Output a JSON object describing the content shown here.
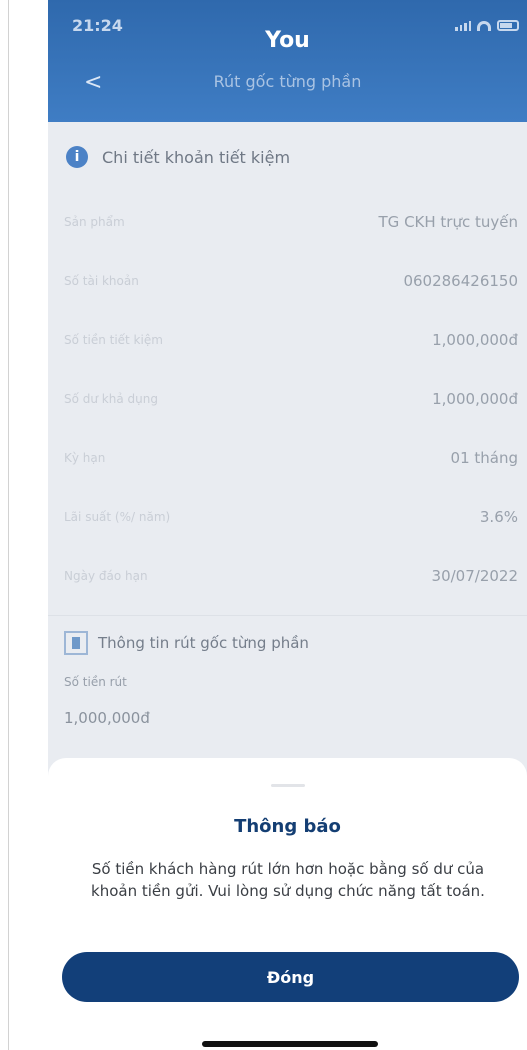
{
  "status_bar": {
    "time": "21:24"
  },
  "header": {
    "brand": "You",
    "back_symbol": "<",
    "title": "Rút gốc từng phần"
  },
  "savings_details": {
    "heading": "Chi tiết khoản tiết kiệm",
    "rows": [
      {
        "label": "Sản phẩm",
        "value": "TG CKH trực tuyến"
      },
      {
        "label": "Số tài khoản",
        "value": "060286426150"
      },
      {
        "label": "Số tiền tiết kiệm",
        "value": "1,000,000đ"
      },
      {
        "label": "Số dư khả dụng",
        "value": "1,000,000đ"
      },
      {
        "label": "Kỳ hạn",
        "value": "01 tháng"
      },
      {
        "label": "Lãi suất (%/ năm)",
        "value": "3.6%"
      },
      {
        "label": "Ngày đáo hạn",
        "value": "30/07/2022"
      }
    ]
  },
  "withdrawal": {
    "heading": "Thông tin rút gốc từng phần",
    "amount_label": "Số tiền rút",
    "amount_value": "1,000,000đ"
  },
  "dialog": {
    "title": "Thông báo",
    "message": "Số tiền khách hàng rút lớn hơn hoặc bằng số dư của khoản tiền gửi. Vui lòng sử dụng chức năng tất toán.",
    "button_label": "Đóng"
  },
  "colors": {
    "header": "#3a76bd",
    "primary_button": "#123f79",
    "title_text": "#143e73"
  }
}
